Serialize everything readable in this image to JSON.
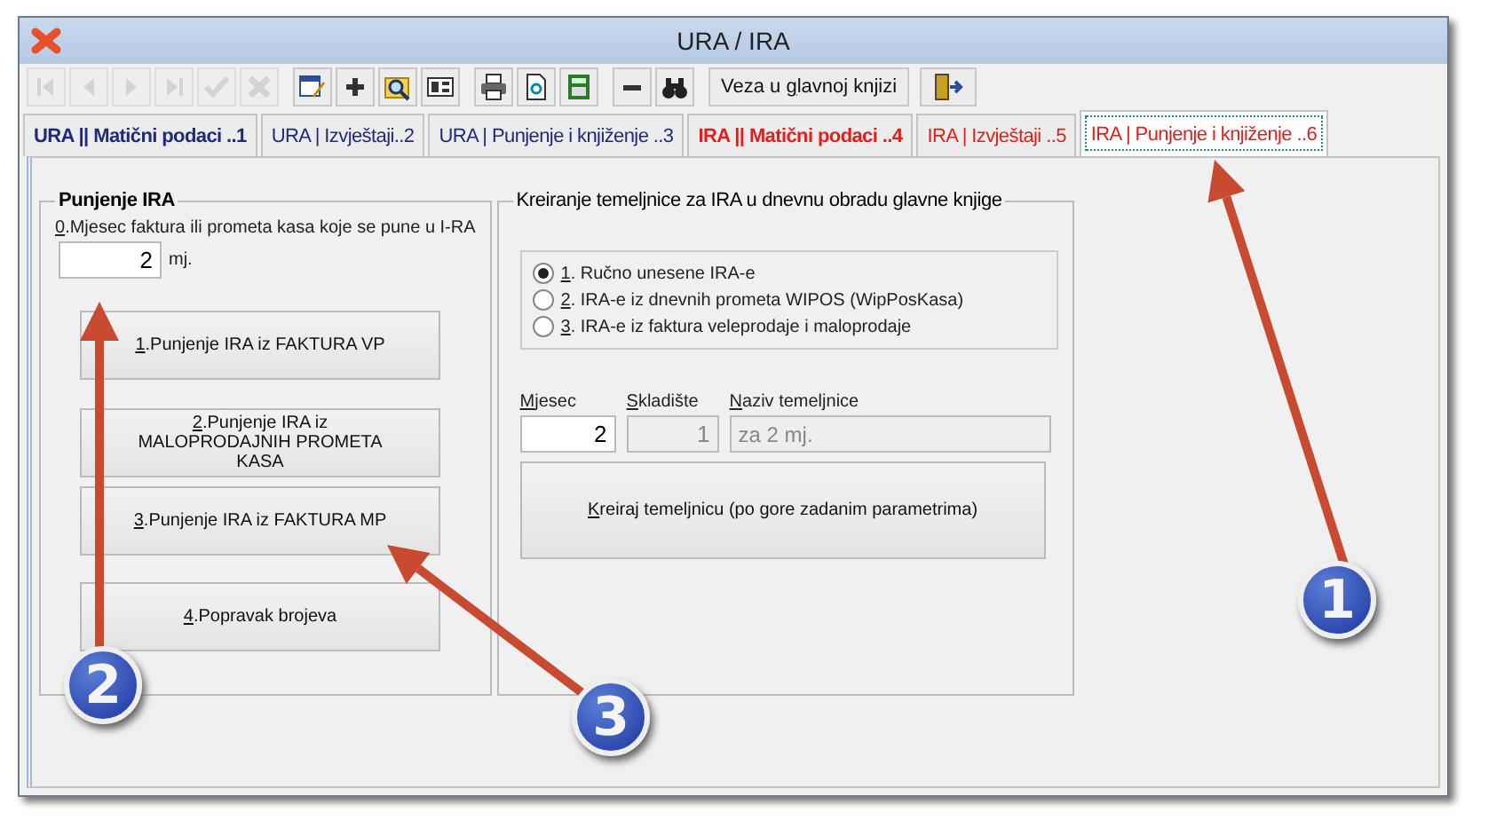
{
  "window": {
    "title": "URA / IRA"
  },
  "toolbar": {
    "icons": [
      {
        "kind": "first",
        "disabled": true
      },
      {
        "kind": "prev",
        "disabled": true
      },
      {
        "kind": "next",
        "disabled": true
      },
      {
        "kind": "last",
        "disabled": true
      },
      {
        "kind": "check",
        "disabled": true
      },
      {
        "kind": "cross",
        "disabled": true
      },
      {
        "kind": "edit",
        "disabled": false
      },
      {
        "kind": "plus",
        "disabled": false
      },
      {
        "kind": "find",
        "disabled": false
      },
      {
        "kind": "form",
        "disabled": false
      },
      {
        "kind": "print",
        "disabled": false
      },
      {
        "kind": "preview",
        "disabled": false
      },
      {
        "kind": "calc",
        "disabled": false
      },
      {
        "kind": "minus",
        "disabled": false
      },
      {
        "kind": "binoculars",
        "disabled": false
      }
    ],
    "link_button": {
      "pre": "Veza u ",
      "key": "g",
      "post": "lavnoj knjizi"
    }
  },
  "tabs": [
    {
      "label": "URA || Matični podaci ..1",
      "selected": false,
      "bold": true,
      "color": "#1f2a7a"
    },
    {
      "label": "URA | Izvještaji..2",
      "selected": false,
      "bold": false,
      "color": "#1f2a7a"
    },
    {
      "label": "URA | Punjenje i knjiženje ..3",
      "selected": false,
      "bold": false,
      "color": "#1f2a7a"
    },
    {
      "label": "IRA || Matični podaci ..4",
      "selected": false,
      "bold": true,
      "color": "#e0201c"
    },
    {
      "label": "IRA | Izvještaji ..5",
      "selected": false,
      "bold": false,
      "color": "#e0201c"
    },
    {
      "label": "IRA | Punjenje i knjiženje ..6",
      "selected": true,
      "bold": false,
      "color": "#e0201c"
    }
  ],
  "fill_group": {
    "title": "Punjenje IRA",
    "month_label": {
      "key": "0",
      "post": ".Mjesec faktura ili prometa kasa koje se pune u I-RA"
    },
    "month_value": "2",
    "unit": "mj.",
    "buttons": [
      {
        "key": "1",
        "post": ".Punjenje IRA iz FAKTURA VP"
      },
      {
        "key": "2",
        "post": ".Punjenje IRA iz MALOPRODAJNIH PROMETA KASA"
      },
      {
        "key": "3",
        "post": ".Punjenje IRA iz FAKTURA MP"
      },
      {
        "key": "4",
        "post": ".Popravak brojeva"
      }
    ]
  },
  "journal_group": {
    "title": "Kreiranje temeljnice za IRA u dnevnu obradu glavne knjige",
    "options": [
      {
        "key": "1",
        "post": ". Ručno unesene IRA-e",
        "selected": true
      },
      {
        "key": "2",
        "post": ". IRA-e iz dnevnih prometa WIPOS (WipPosKasa)",
        "selected": false
      },
      {
        "key": "3",
        "post": ". IRA-e iz faktura veleprodaje i maloprodaje",
        "selected": false
      }
    ],
    "fields": [
      {
        "key": "M",
        "post": "jesec",
        "value": "2",
        "disabled": false
      },
      {
        "key": "S",
        "post": "kladište",
        "value": "1",
        "disabled": true
      },
      {
        "key": "N",
        "post": "aziv temeljnice",
        "value": "za 2 mj.",
        "disabled": true
      }
    ],
    "create_button": {
      "key": "K",
      "post": "reiraj temeljnicu (po gore zadanim parametrima)"
    }
  },
  "callouts": [
    "1",
    "2",
    "3"
  ]
}
